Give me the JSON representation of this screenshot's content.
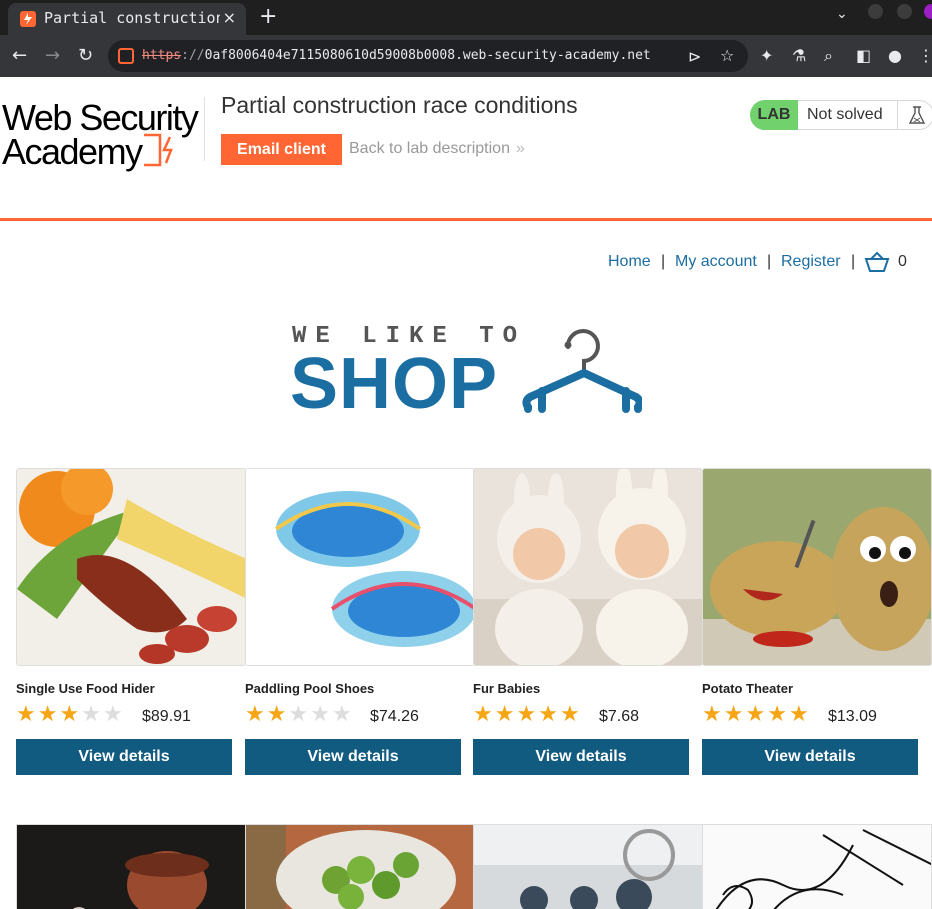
{
  "browser": {
    "tab_title": "Partial construction race conditions",
    "tab_close": "×",
    "new_tab": "+",
    "url_scheme": "https",
    "url_sep": "://",
    "url_rest": "0af8006404e7115080610d59008b0008.web-security-academy.net"
  },
  "header": {
    "logo_line1": "Web Security",
    "logo_line2": "Academy",
    "lab_title": "Partial construction race conditions",
    "email_client": "Email client",
    "back_link": "Back to lab description",
    "back_arrow": "»",
    "lab_badge": "LAB",
    "lab_status": "Not solved"
  },
  "nav": {
    "home": "Home",
    "my_account": "My account",
    "register": "Register",
    "pipe": "|",
    "cart_count": "0"
  },
  "banner": {
    "tagline": "WE LIKE TO",
    "shop": "SHOP"
  },
  "products": [
    {
      "name": "Single Use Food Hider",
      "rating": 3,
      "price": "$89.91",
      "button": "View details"
    },
    {
      "name": "Paddling Pool Shoes",
      "rating": 2,
      "price": "$74.26",
      "button": "View details"
    },
    {
      "name": "Fur Babies",
      "rating": 5,
      "price": "$7.68",
      "button": "View details"
    },
    {
      "name": "Potato Theater",
      "rating": 5,
      "price": "$13.09",
      "button": "View details"
    }
  ],
  "colors": {
    "accent": "#ff6633",
    "link": "#1b6ea1",
    "button": "#115a80",
    "lab_green": "#70d16d",
    "star": "#f6a615"
  }
}
